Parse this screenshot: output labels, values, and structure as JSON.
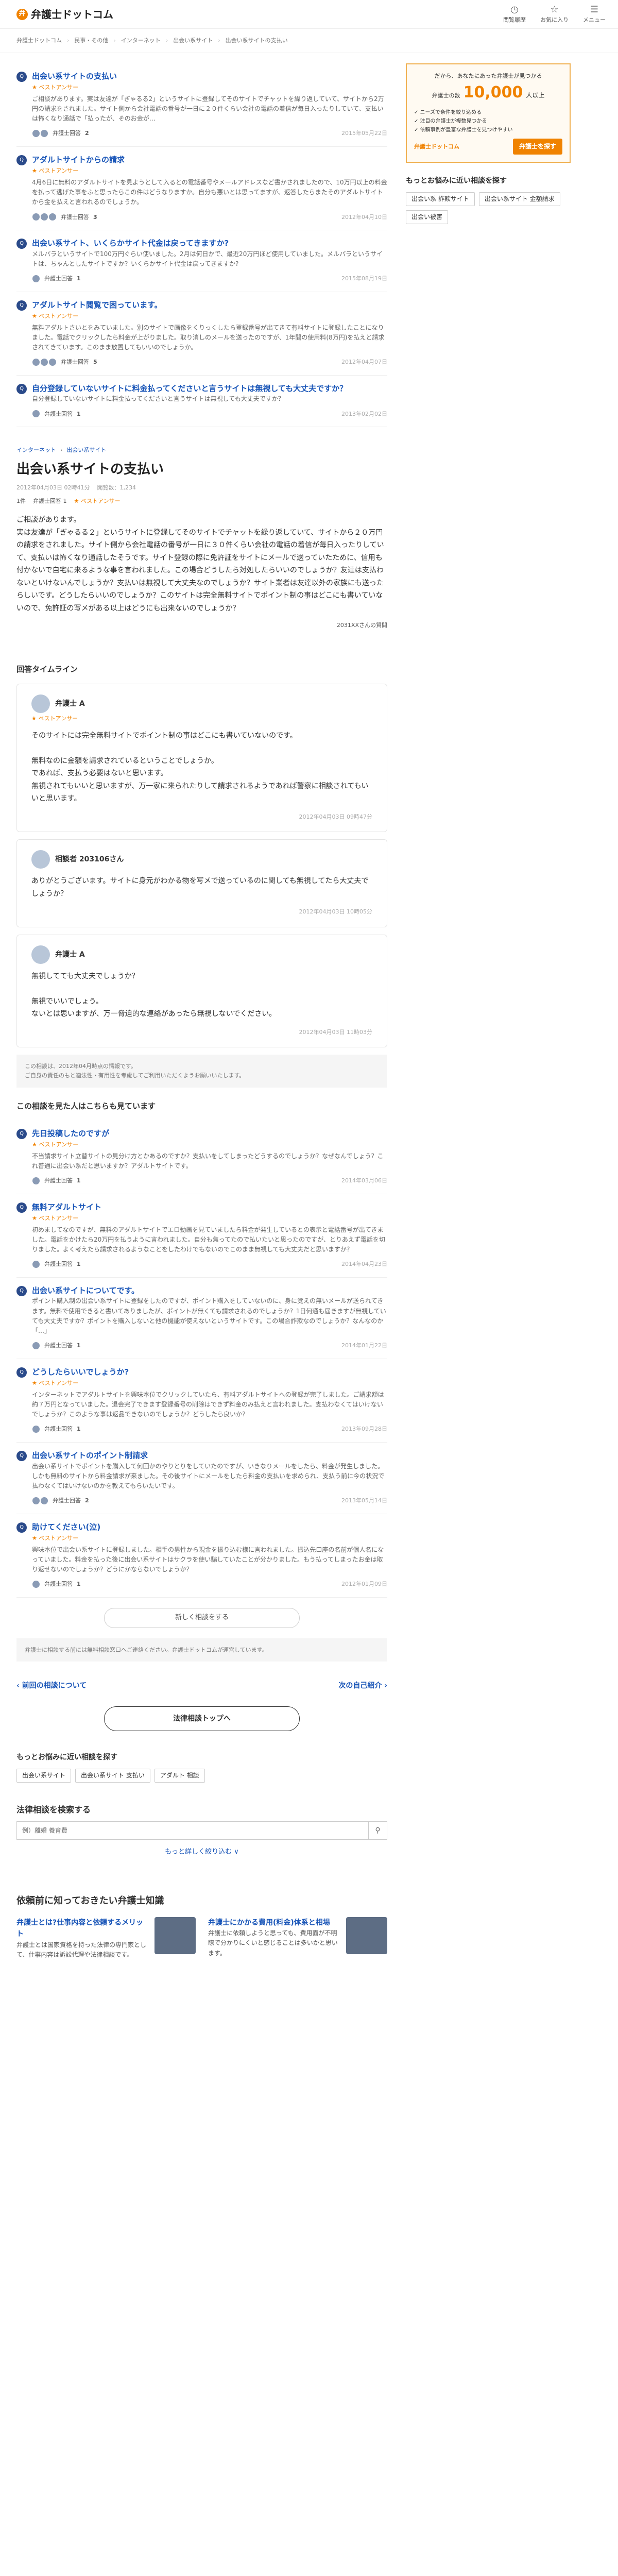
{
  "header": {
    "logo_mark": "弁",
    "logo": "弁護士ドットコム",
    "nav": [
      {
        "icon": "clock-icon",
        "glyph": "◷",
        "label": "閲覧履歴"
      },
      {
        "icon": "star-icon",
        "glyph": "☆",
        "label": "お気に入り"
      },
      {
        "icon": "menu-icon",
        "glyph": "☰",
        "label": "メニュー"
      }
    ]
  },
  "breadcrumb": [
    "弁護士ドットコム",
    "民事・その他",
    "インターネット",
    "出会い系サイト",
    "出会い系サイトの支払い"
  ],
  "top_related": [
    {
      "title": "出会い系サイトの支払い",
      "best": "★ ベストアンサー",
      "text": "ご相談があります。実は友達が「ぎゃるる2」というサイトに登録してそのサイトでチャットを繰り返していて、サイトから2万円の請求をされました。サイト側から会社電話の番号が一日に２０件くらい会社の電話の着信が毎日入ったりしていて、支払いは怖くなり通話で「払ったが、そのお金が…",
      "count": "2",
      "date": "2015年05月22日"
    },
    {
      "title": "アダルトサイトからの請求",
      "best": "★ ベストアンサー",
      "text": "4月6日に無料のアダルトサイトを見ようとして入るとの電話番号やメールアドレスなど書かされましたので、10万円以上の料金を払って逃げた事をふと思ったらこの件はどうなりますか。自分も悪いとは思ってますが、返答したらまたそのアダルトサイトから金を払えと言われるのでしょうか。",
      "count": "3",
      "date": "2012年04月10日"
    },
    {
      "title": "出会い系サイト、いくらかサイト代金は戻ってきますか?",
      "best": "",
      "text": "メルパラというサイトで100万円ぐらい使いました。2月は何日かで、最近20万円ほど使用していました。メルパラというサイトは、ちゃんとしたサイトですか？いくらかサイト代金は戻ってきますか?",
      "count": "1",
      "date": "2015年08月19日"
    },
    {
      "title": "アダルトサイト閲覧で困っています。",
      "best": "★ ベストアンサー",
      "text": "無料アダルトさいとをみていました。別のサイトで画像をくりっくしたら登録番号が出てきて有料サイトに登録したことになりました。電話でクリックしたら料金が上がりました。取り消しのメールを送ったのですが、1年間の使用料(8万円)を払えと請求されてきています。このまま放置してもいいのでしょうか。",
      "count": "5",
      "date": "2012年04月07日"
    },
    {
      "title": "自分登録していないサイトに料金払ってくださいと言うサイトは無視しても大丈夫ですか？",
      "best": "",
      "text": "自分登録していないサイトに料金払ってくださいと言うサイトは無視しても大丈夫ですか？",
      "count": "1",
      "date": "2013年02月02日"
    }
  ],
  "question": {
    "category": [
      "インターネット",
      "出会い系サイト"
    ],
    "title": "出会い系サイトの支払い",
    "posted": "2012年04月03日 02時41分",
    "views": "閲覧数：1,234",
    "answers_label": "1件",
    "best_label": "★ ベストアンサー",
    "lawyers": "弁護士回答 1",
    "body": "ご相談があります。\n実は友達が「ぎゃるる２」というサイトに登録してそのサイトでチャットを繰り返していて、サイトから２０万円の請求をされました。サイト側から会社電話の番号が一日に３０件くらい会社の電話の着信が毎日入ったりしていて、支払いは怖くなり通話したそうです。サイト登録の際に免許証をサイトにメールで送っていたために、信用も付かないで自宅に来るような事を言われました。この場合どうしたら対処したらいいのでしょうか？友達は支払わないといけないんでしょうか？支払いは無視して大丈夫なのでしょうか？サイト業者は友達以外の家族にも送ったらしいです。どうしたらいいのでしょうか？このサイトは完全無料サイトでポイント制の事はどこにも書いていないので、免許証の写メがある以上はどうにも出来ないのでしょうか？",
    "asker": "2031XXさんの質問"
  },
  "timeline_title": "回答タイムライン",
  "answers": [
    {
      "name": "弁護士 A",
      "best": "★ ベストアンサー",
      "text": "そのサイトには完全無料サイトでポイント制の事はどこにも書いていないのです。\n\n無料なのに金額を請求されているということでしょうか。\nであれば、支払う必要はないと思います。\n無視されてもいいと思いますが、万一家に来られたりして請求されるようであれば警察に相談されてもいいと思います。",
      "date": "2012年04月03日 09時47分"
    },
    {
      "name": "相談者 203106さん",
      "best": "",
      "text": "ありがとうございます。サイトに身元がわかる物を写メで送っているのに関しても無視してたら大丈夫でしょうか？",
      "date": "2012年04月03日 10時05分"
    },
    {
      "name": "弁護士 A",
      "best": "",
      "text": "無視してても大丈夫でしょうか？\n\n無視でいいでしょう。\nないとは思いますが、万一脅迫的な連絡があったら無視しないでください。",
      "date": "2012年04月03日 11時03分"
    }
  ],
  "note": "この相談は、2012年04月時点の情報です。\nご自身の責任のもと適法性・有用性を考慮してご利用いただくようお願いいたします。",
  "similar_title": "この相談を見た人はこちらも見ています",
  "similar": [
    {
      "title": "先日投稿したのですが",
      "best": "★ ベストアンサー",
      "text": "不当請求サイト立替サイトの見分け方とかあるのですか？支払いをしてしまったどうするのでしょうか？なぜなんでしょう？これ普通に出会い系だと思いますか？アダルトサイトです。",
      "count": "1",
      "date": "2014年03月06日"
    },
    {
      "title": "無料アダルトサイト",
      "best": "★ ベストアンサー",
      "text": "初めましてなのですが、無料のアダルトサイトでエロ動画を見ていましたら料金が発生しているとの表示と電話番号が出てきました。電話をかけたら20万円を払うように言われました。自分も焦ってたので払いたいと思ったのですが、とりあえず電話を切りました。よく考えたら請求されるようなことをしたわけでもないのでこのまま無視しても大丈夫だと思いますか？",
      "count": "1",
      "date": "2014年04月23日"
    },
    {
      "title": "出会い系サイトについてです。",
      "best": "",
      "text": "ポイント購入制の出会い系サイトに登録をしたのですが、ポイント購入をしていないのに、身に覚えの無いメールが送られてきます。無料で使用できると書いてありましたが、ポイントが無くても請求されるのでしょうか？1日何通も届きますが無視していても大丈夫ですか？ポイントを購入しないと他の機能が使えないというサイトです。この場合詐欺なのでしょうか？なんなのか「…」",
      "count": "1",
      "date": "2014年01月22日"
    },
    {
      "title": "どうしたらいいでしょうか?",
      "best": "★ ベストアンサー",
      "text": "インターネットでアダルトサイトを興味本位でクリックしていたら、有料アダルトサイトへの登録が完了しました。ご請求額は約７万円となっていました。退会完了できます登録番号の削除はできず料金のみ払えと言われました。支払わなくてはいけないでしょうか？このような事は返品できないのでしょうか？どうしたら良いか？",
      "count": "1",
      "date": "2013年09月28日"
    },
    {
      "title": "出会い系サイトのポイント制請求",
      "best": "",
      "text": "出会い系サイトでポイントを購入して何回かのやりとりをしていたのですが、いきなりメールをしたら、料金が発生しました。しかも無料のサイトから料金請求が来ました。その後サイトにメールをしたら料金の支払いを求められ、支払う前に今の状況で払わなくてはいけないのかを教えてもらいたいです。",
      "count": "2",
      "date": "2013年05月14日"
    },
    {
      "title": "助けてください(泣)",
      "best": "★ ベストアンサー",
      "text": "興味本位で出会い系サイトに登録しました。相手の男性から現金を振り込む様に言われました。振込先口座の名前が個人名になっていました。料金を払った後に出会い系サイトはサクラを使い騙していたことが分かりました。もう払ってしまったお金は取り返せないのでしょうか？どうにかならないでしょうか？",
      "count": "1",
      "date": "2012年01月09日"
    }
  ],
  "more_button": "新しく相談をする",
  "footer_note": "弁護士に相談する前には無料相談窓口へご連絡ください。弁護士ドットコムが運営しています。",
  "prev_link": "‹ 前回の相談について",
  "next_link": "次の自己紹介 ›",
  "top_button": "法律相談トップへ",
  "more_worries": {
    "title": "もっとお悩みに近い相談を探す",
    "chips": [
      "出会い系サイト",
      "出会い系サイト 支払い",
      "アダルト 相談"
    ]
  },
  "search": {
    "title": "法律相談を検索する",
    "placeholder": "例）離婚 養育費",
    "more": "もっと詳しく絞り込む ∨"
  },
  "kw": {
    "title": "依頼前に知っておきたい弁護士知識",
    "items": [
      {
        "title": "弁護士とは?仕事内容と依頼するメリット",
        "desc": "弁護士とは国家資格を持った法律の専門家として、仕事内容は訴訟代理や法律相談です。"
      },
      {
        "title": "弁護士にかかる費用(料金)体系と相場",
        "desc": "弁護士に依頼しようと思っても、費用面が不明瞭で分かりにくいと感じることは多いかと思います。"
      }
    ]
  },
  "ad": {
    "lead": "だから、あなたにあった弁護士が見つかる",
    "label": "弁護士の数",
    "number": "10,000",
    "unit": "人以上",
    "points": [
      "✓ ニーズで条件を絞り込める",
      "✓ 注目の弁護士が複数見つかる",
      "✓ 依頼事例が豊富な弁護士を見つけやすい"
    ],
    "logo": "弁護士ドットコム",
    "button": "弁護士を探す"
  },
  "side_more": {
    "title": "もっとお悩みに近い相談を探す",
    "chips": [
      "出会い系 詐欺サイト",
      "出会い系サイト 金額請求",
      "出会い被害"
    ]
  }
}
